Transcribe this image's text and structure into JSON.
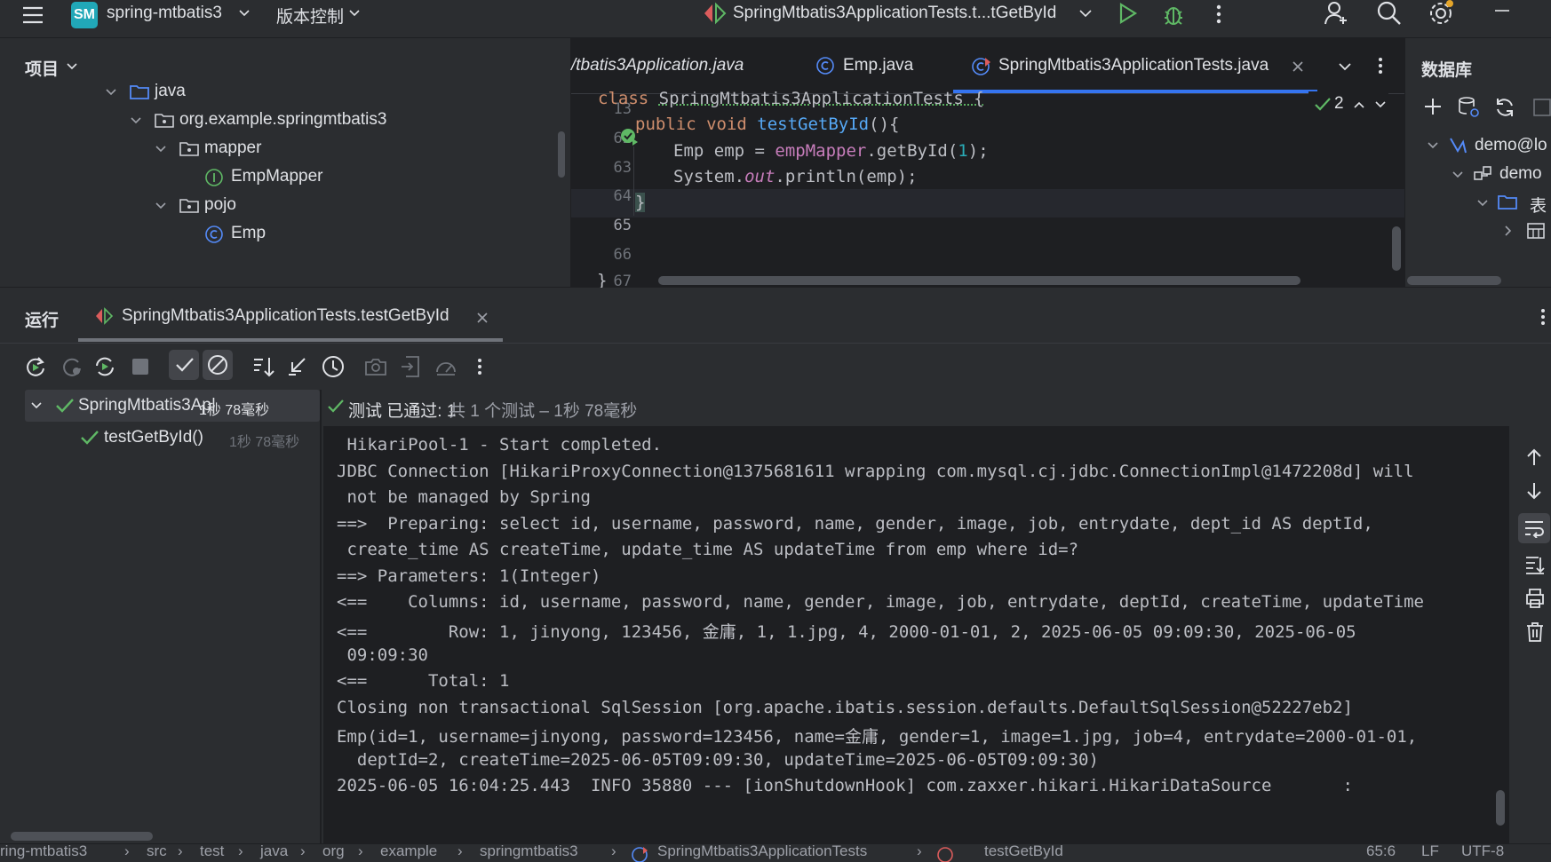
{
  "titlebar": {
    "project_badge": "SM",
    "project_name": "spring-mtbatis3",
    "vcs_label": "版本控制",
    "run_config": "SpringMtbatis3ApplicationTests.t...tGetById"
  },
  "project_panel": {
    "title": "项目",
    "tree": [
      {
        "label": "java",
        "icon": "folder-icon"
      },
      {
        "label": "org.example.springmtbatis3",
        "icon": "package-icon"
      },
      {
        "label": "mapper",
        "icon": "package-icon"
      },
      {
        "label": "EmpMapper",
        "icon": "interface-icon"
      },
      {
        "label": "pojo",
        "icon": "package-icon"
      },
      {
        "label": "Emp",
        "icon": "class-icon"
      }
    ]
  },
  "editor": {
    "tabs": [
      {
        "label": "/tbatis3Application.java"
      },
      {
        "label": "Emp.java"
      },
      {
        "label": "SpringMtbatis3ApplicationTests.java",
        "active": true
      }
    ],
    "inspection_count": "2",
    "line_numbers": [
      "13",
      "62",
      "63",
      "64",
      "65",
      "66",
      "67"
    ],
    "code": {
      "l13_kw": "class ",
      "l13_rest": "SpringMtbatis3ApplicationTests {",
      "l62_kw": "public void ",
      "l62_fn": "testGetById",
      "l62_rest": "(){",
      "l63_a": "Emp emp = ",
      "l63_field": "empMapper",
      "l63_b": ".getById(",
      "l63_num": "1",
      "l63_c": ");",
      "l64_a": "System.",
      "l64_out": "out",
      "l64_b": ".println(emp);",
      "l65": "}",
      "l67": "}"
    }
  },
  "database_panel": {
    "title": "数据库",
    "items": [
      "demo@lo",
      "demo",
      "表"
    ]
  },
  "run_panel": {
    "title": "运行",
    "tab_label": "SpringMtbatis3ApplicationTests.testGetById",
    "tests": [
      {
        "name": "SpringMtbatis3Ap|",
        "time": "1秒 78毫秒"
      },
      {
        "name": "testGetById()",
        "time": "1秒 78毫秒"
      }
    ],
    "summary": {
      "passed": "测试 已通过: 1",
      "detail": "共 1 个测试 – 1秒 78毫秒"
    },
    "console": [
      " HikariPool-1 - Start completed.",
      "JDBC Connection [HikariProxyConnection@1375681611 wrapping com.mysql.cj.jdbc.ConnectionImpl@1472208d] will",
      " not be managed by Spring",
      "==>  Preparing: select id, username, password, name, gender, image, job, entrydate, dept_id AS deptId,",
      " create_time AS createTime, update_time AS updateTime from emp where id=?",
      "==> Parameters: 1(Integer)",
      "<==    Columns: id, username, password, name, gender, image, job, entrydate, deptId, createTime, updateTime",
      "<==        Row: 1, jinyong, 123456, 金庸, 1, 1.jpg, 4, 2000-01-01, 2, 2025-06-05 09:09:30, 2025-06-05",
      " 09:09:30",
      "<==      Total: 1",
      "Closing non transactional SqlSession [org.apache.ibatis.session.defaults.DefaultSqlSession@52227eb2]",
      "Emp(id=1, username=jinyong, password=123456, name=金庸, gender=1, image=1.jpg, job=4, entrydate=2000-01-01,",
      "  deptId=2, createTime=2025-06-05T09:09:30, updateTime=2025-06-05T09:09:30)",
      "2025-06-05 16:04:25.443  INFO 35880 --- [ionShutdownHook] com.zaxxer.hikari.HikariDataSource       :"
    ]
  },
  "statusbar": {
    "breadcrumbs": [
      "ring-mtbatis3",
      "src",
      "test",
      "java",
      "org",
      "example",
      "springmtbatis3",
      "SpringMtbatis3ApplicationTests",
      "testGetById"
    ],
    "position": "65:6",
    "line_ending": "LF",
    "encoding": "UTF-8"
  },
  "colors": {
    "accent": "#3574f0",
    "pass_green": "#5fb865",
    "background": "#1e1f22",
    "panel": "#2b2d30"
  }
}
